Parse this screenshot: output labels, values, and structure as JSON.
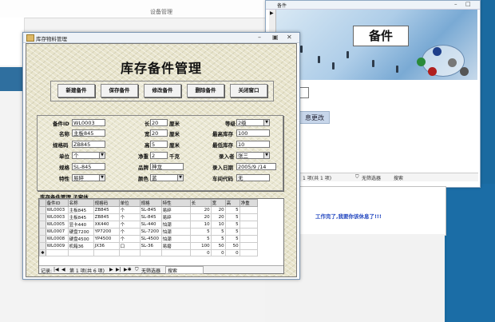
{
  "background": {
    "title": "设备管理"
  },
  "spare_window": {
    "title": "备件",
    "banner_text": "备件",
    "side_text": "息更改",
    "shape_text": "息",
    "nav": {
      "record": "1 项(共 1 项)",
      "filter": "无筛选器",
      "search": "搜索"
    }
  },
  "message_window": {
    "text": "工作完了,我要你该休息了!!!"
  },
  "main_window": {
    "title": "库存物料管理",
    "form_title": "库存备件管理",
    "buttons": [
      "新建备件",
      "保存备件",
      "修改备件",
      "删除备件",
      "关闭窗口"
    ],
    "fields": {
      "part_id": {
        "label": "备件ID",
        "value": "WL0003"
      },
      "name": {
        "label": "名称",
        "value": "主板845"
      },
      "model": {
        "label": "规格码",
        "value": "ZB845"
      },
      "unit": {
        "label": "单位",
        "value": "个"
      },
      "spec": {
        "label": "规格",
        "value": "SL-845"
      },
      "feature": {
        "label": "特性",
        "value": "易碎"
      },
      "length": {
        "label": "长",
        "value": "20",
        "unit": "厘米"
      },
      "width": {
        "label": "宽",
        "value": "20",
        "unit": "厘米"
      },
      "height": {
        "label": "高",
        "value": "5",
        "unit": "厘米"
      },
      "net_weight": {
        "label": "净重",
        "value": "2",
        "unit": "千克"
      },
      "brand": {
        "label": "品牌",
        "value": "神龙"
      },
      "color": {
        "label": "颜色",
        "value": "蓝"
      },
      "grade": {
        "label": "等级",
        "value": "2级"
      },
      "max_stock": {
        "label": "最高库存",
        "value": "100"
      },
      "min_stock": {
        "label": "最低库存",
        "value": "10"
      },
      "entered_by": {
        "label": "录入者",
        "value": "张三"
      },
      "entry_date": {
        "label": "录入日期",
        "value": "2005/9 /14"
      },
      "vehicle_code": {
        "label": "车间代码",
        "value": "无"
      }
    },
    "subform": {
      "title": "库存备件管理 子窗体",
      "columns": [
        "备件ID",
        "名称",
        "规格码",
        "单位",
        "规格",
        "特性",
        "长",
        "宽",
        "高",
        "净重"
      ],
      "rows": [
        [
          "WL0003",
          "主板845",
          "ZB845",
          "个",
          "SL-845",
          "易碎",
          "20",
          "20",
          "5",
          ""
        ],
        [
          "WL0003",
          "主板845",
          "ZB845",
          "个",
          "SL-845",
          "易碎",
          "20",
          "20",
          "5",
          ""
        ],
        [
          "WL0005",
          "显卡440",
          "XK440",
          "个",
          "SL-440",
          "怕潮",
          "10",
          "10",
          "5",
          ""
        ],
        [
          "WL0007",
          "硬盘7200",
          "YP7200",
          "个",
          "SL-7200",
          "怕潮",
          "5",
          "5",
          "5",
          ""
        ],
        [
          "WL0008",
          "硬盘4500",
          "YP4500",
          "个",
          "SL-4500",
          "怕潮",
          "5",
          "5",
          "5",
          ""
        ],
        [
          "WL0009",
          "机箱36",
          "JX36",
          "口",
          "SL-36",
          "易磨",
          "100",
          "50",
          "50",
          ""
        ],
        [
          "",
          "",
          "",
          "",
          "",
          "",
          "0",
          "0",
          "0",
          ""
        ]
      ],
      "nav": {
        "label": "记录:",
        "record": "第 1 项(共 6 项)",
        "filter": "无筛选器",
        "search": "搜索"
      }
    }
  }
}
